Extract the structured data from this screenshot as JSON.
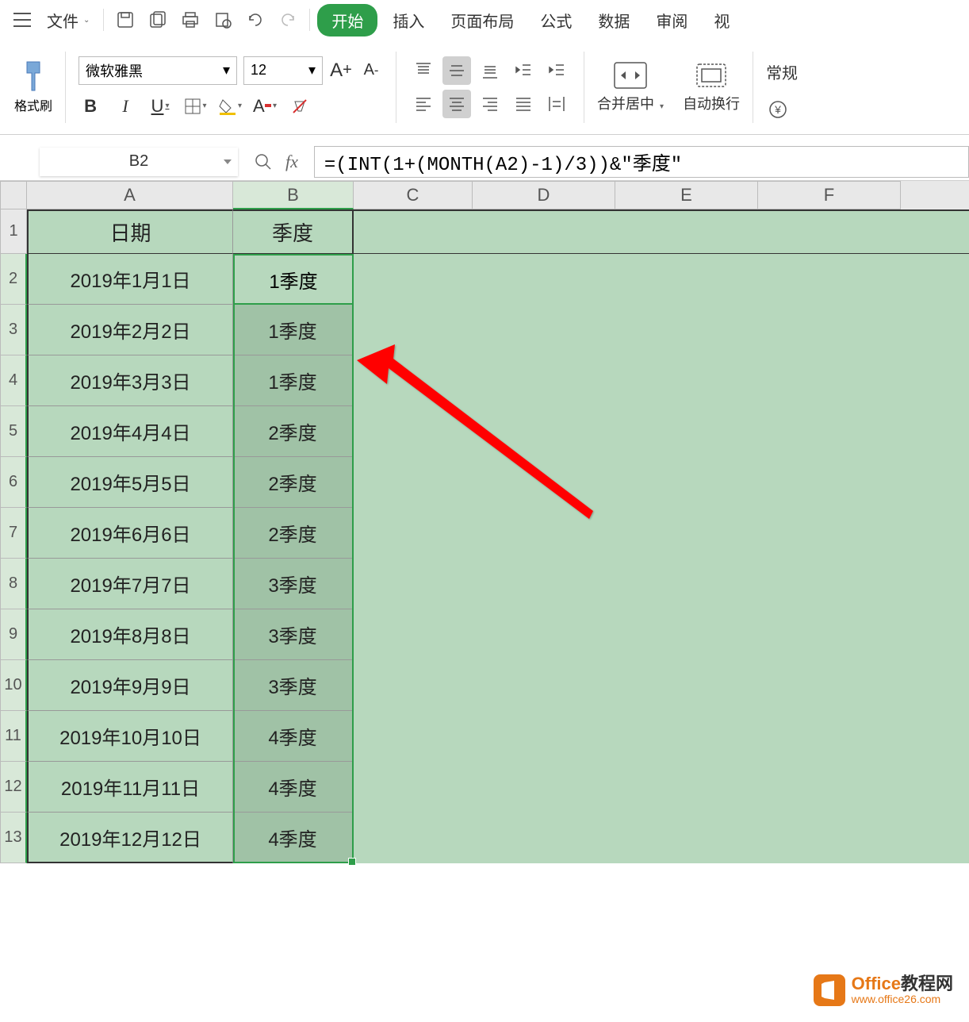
{
  "menu": {
    "file": "文件",
    "tabs": {
      "start": "开始",
      "insert": "插入",
      "page_layout": "页面布局",
      "formulas": "公式",
      "data": "数据",
      "review": "审阅",
      "view": "视"
    }
  },
  "ribbon": {
    "format_painter": "格式刷",
    "font_name": "微软雅黑",
    "font_size": "12",
    "merge_center": "合并居中",
    "auto_wrap": "自动换行",
    "general": "常规"
  },
  "name_box": "B2",
  "formula": "=(INT(1+(MONTH(A2)-1)/3))&\"季度\"",
  "columns": [
    "A",
    "B",
    "C",
    "D",
    "E",
    "F"
  ],
  "rows": [
    "1",
    "2",
    "3",
    "4",
    "5",
    "6",
    "7",
    "8",
    "9",
    "10",
    "11",
    "12",
    "13"
  ],
  "table": {
    "headers": {
      "date": "日期",
      "quarter": "季度"
    },
    "data": [
      {
        "date": "2019年1月1日",
        "quarter": "1季度"
      },
      {
        "date": "2019年2月2日",
        "quarter": "1季度"
      },
      {
        "date": "2019年3月3日",
        "quarter": "1季度"
      },
      {
        "date": "2019年4月4日",
        "quarter": "2季度"
      },
      {
        "date": "2019年5月5日",
        "quarter": "2季度"
      },
      {
        "date": "2019年6月6日",
        "quarter": "2季度"
      },
      {
        "date": "2019年7月7日",
        "quarter": "3季度"
      },
      {
        "date": "2019年8月8日",
        "quarter": "3季度"
      },
      {
        "date": "2019年9月9日",
        "quarter": "3季度"
      },
      {
        "date": "2019年10月10日",
        "quarter": "4季度"
      },
      {
        "date": "2019年11月11日",
        "quarter": "4季度"
      },
      {
        "date": "2019年12月12日",
        "quarter": "4季度"
      }
    ]
  },
  "watermark": {
    "title_prefix": "Office",
    "title_suffix": "教程网",
    "url": "www.office26.com"
  }
}
